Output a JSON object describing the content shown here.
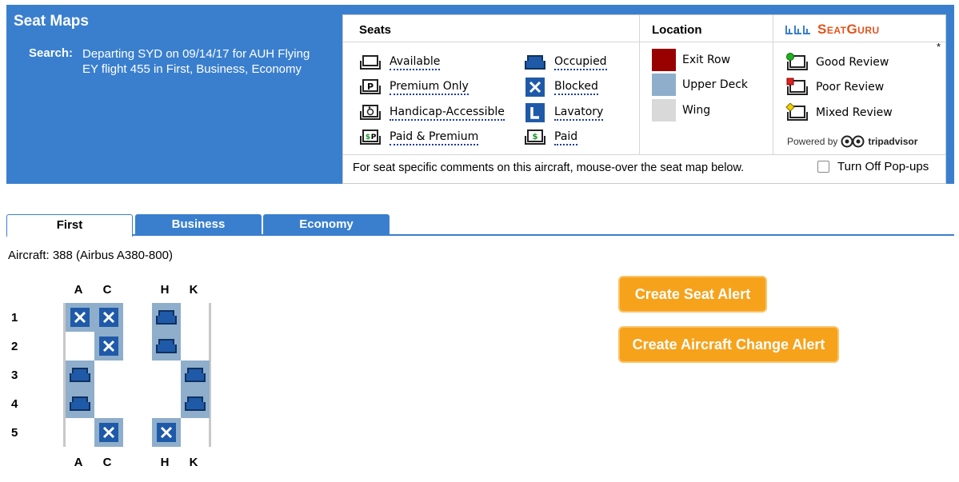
{
  "header": {
    "title": "Seat Maps",
    "search_label": "Search:",
    "search_text": "Departing SYD on 09/14/17 for AUH Flying EY flight 455 in First, Business, Economy"
  },
  "legend": {
    "seats_heading": "Seats",
    "location_heading": "Location",
    "seats": [
      {
        "label": "Available",
        "icon": "seat-available-icon"
      },
      {
        "label": "Premium Only",
        "icon": "seat-premium-icon"
      },
      {
        "label": "Handicap-Accessible",
        "icon": "seat-handicap-icon"
      },
      {
        "label": "Paid & Premium",
        "icon": "seat-paid-premium-icon"
      },
      {
        "label": "Occupied",
        "icon": "seat-occupied-icon"
      },
      {
        "label": "Blocked",
        "icon": "seat-blocked-icon"
      },
      {
        "label": "Lavatory",
        "icon": "lavatory-icon"
      },
      {
        "label": "Paid",
        "icon": "seat-paid-icon"
      }
    ],
    "locations": [
      {
        "label": "Exit Row",
        "color": "#990000"
      },
      {
        "label": "Upper Deck",
        "color": "#8eaecb"
      },
      {
        "label": "Wing",
        "color": "#d9d9d9"
      }
    ],
    "brand": "SeatGuru",
    "reviews": [
      {
        "label": "Good Review",
        "icon": "good-review-icon",
        "color": "#1fb01f"
      },
      {
        "label": "Poor Review",
        "icon": "poor-review-icon",
        "color": "#e02020"
      },
      {
        "label": "Mixed Review",
        "icon": "mixed-review-icon",
        "color": "#f0d000"
      }
    ],
    "asterisk": "*",
    "powered_by": "Powered by",
    "tripadvisor": "tripadvisor",
    "footer_text": "For seat specific comments on this aircraft, mouse-over the seat map below.",
    "popups_label": "Turn Off Pop-ups"
  },
  "tabs": [
    {
      "label": "First",
      "active": true
    },
    {
      "label": "Business",
      "active": false
    },
    {
      "label": "Economy",
      "active": false
    }
  ],
  "aircraft": "Aircraft: 388 (Airbus A380-800)",
  "seatmap": {
    "columns": [
      "A",
      "C",
      "H",
      "K"
    ],
    "rows": [
      "1",
      "2",
      "3",
      "4",
      "5"
    ]
  },
  "alerts": {
    "seat_alert": "Create Seat Alert",
    "aircraft_alert": "Create Aircraft Change Alert"
  }
}
